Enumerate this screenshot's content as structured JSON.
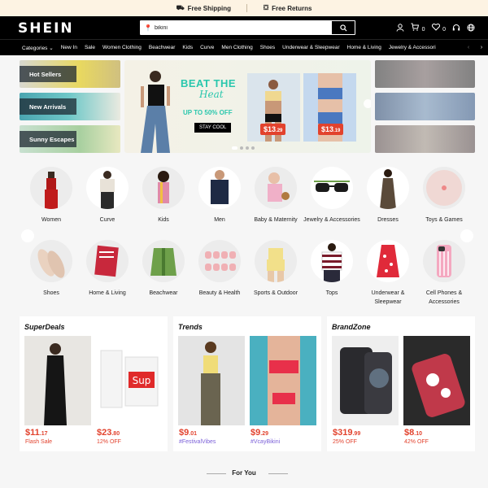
{
  "topbar": {
    "shipping": "Free Shipping",
    "returns": "Free Returns"
  },
  "header": {
    "logo": "SHEIN",
    "search_value": "bikini",
    "cart_count": "0",
    "wishlist_count": "0"
  },
  "nav": {
    "items": [
      "Categories",
      "New In",
      "Sale",
      "Women Clothing",
      "Beachwear",
      "Kids",
      "Curve",
      "Men Clothing",
      "Shoes",
      "Underwear & Sleepwear",
      "Home & Living",
      "Jewelry & Accessori"
    ]
  },
  "hero": {
    "tiles": [
      "Hot Sellers",
      "New Arrivals",
      "Sunny Escapes"
    ],
    "banner": {
      "headline": "BEAT THE",
      "script": "Heat",
      "offer": "UP TO 50% OFF",
      "cta": "STAY COOL",
      "price1_main": "$13",
      "price1_cents": ".29",
      "price2_main": "$13",
      "price2_cents": ".19"
    }
  },
  "categories": [
    "Women",
    "Curve",
    "Kids",
    "Men",
    "Baby & Maternity",
    "Jewelry & Accessories",
    "Dresses",
    "Toys & Games",
    "Shoes",
    "Home & Living",
    "Beachwear",
    "Beauty & Health",
    "Sports & Outdoor",
    "Tops",
    "Underwear & Sleepwear",
    "Cell Phones & Accessories"
  ],
  "promos": [
    {
      "title": "SuperDeals",
      "items": [
        {
          "price_main": "$11",
          "price_cents": ".17",
          "sub": "Flash Sale"
        },
        {
          "price_main": "$23",
          "price_cents": ".80",
          "sub": "12% OFF"
        }
      ]
    },
    {
      "title": "Trends",
      "items": [
        {
          "price_main": "$9",
          "price_cents": ".01",
          "sub": "#FestivalVibes"
        },
        {
          "price_main": "$9",
          "price_cents": ".29",
          "sub": "#VcayBikini"
        }
      ]
    },
    {
      "title": "BrandZone",
      "items": [
        {
          "price_main": "$319",
          "price_cents": ".99",
          "sub": "25% OFF"
        },
        {
          "price_main": "$8",
          "price_cents": ".10",
          "sub": "42% OFF"
        }
      ]
    }
  ],
  "for_you": "For You",
  "colors": {
    "accent": "#e2422d",
    "teal": "#2ac7ad",
    "header": "#000000",
    "topbar": "#fdf3e3"
  }
}
